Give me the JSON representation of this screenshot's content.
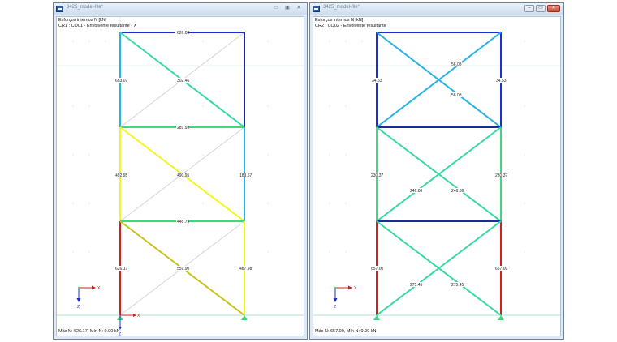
{
  "windows": [
    {
      "id": "left",
      "title": "3425_model-file*",
      "info_line1": "Esforços internos N [kN]",
      "info_line2": "CR1 : CO01 - Envolvente resultante - X",
      "status": "Máx N: 626.17, Mín N: 0.00 kN",
      "controls": [
        "▭",
        "▣",
        "✕"
      ],
      "labels": {
        "top_beam": "626.08",
        "left_col_top": "653.07",
        "diag_top": "302.46",
        "mid_beam_top": "289.92",
        "left_col_mid": "492.95",
        "diag_mid": "490.95",
        "right_col_mid": "189.67",
        "mid_beam_low": "446.75",
        "left_col_low": "626.17",
        "diag_low": "559.90",
        "right_col_low": "487.98"
      }
    },
    {
      "id": "right",
      "title": "3425_model-file*",
      "info_line1": "Esforços internos N [kN]",
      "info_line2": "CR2 : CO02 - Envolvente resultante",
      "status": "Máx N: 657.00, Mín N: 0.00 kN",
      "controls": [
        "–",
        "▭",
        "✕"
      ],
      "labels": {
        "left_col_top": "34.53",
        "right_col_top": "34.53",
        "diag_top_a": "56.03",
        "diag_top_b": "56.03",
        "left_col_mid": "230.37",
        "right_col_mid": "230.37",
        "diag_mid_a": "246.86",
        "diag_mid_b": "246.86",
        "left_col_low": "657.00",
        "right_col_low": "657.00",
        "diag_low_a": "275.45",
        "diag_low_b": "275.45"
      }
    }
  ],
  "axes": {
    "x": "X",
    "z": "Z"
  },
  "colors": {
    "red": "#d02020",
    "yellow": "#f4f41e",
    "olive": "#c9c21c",
    "green": "#3fd97d",
    "teal": "#37d8a4",
    "cyan": "#25b2e6",
    "blue": "#1b2fd0",
    "navy": "#1c2b9a",
    "gray": "#d6d6d6"
  }
}
